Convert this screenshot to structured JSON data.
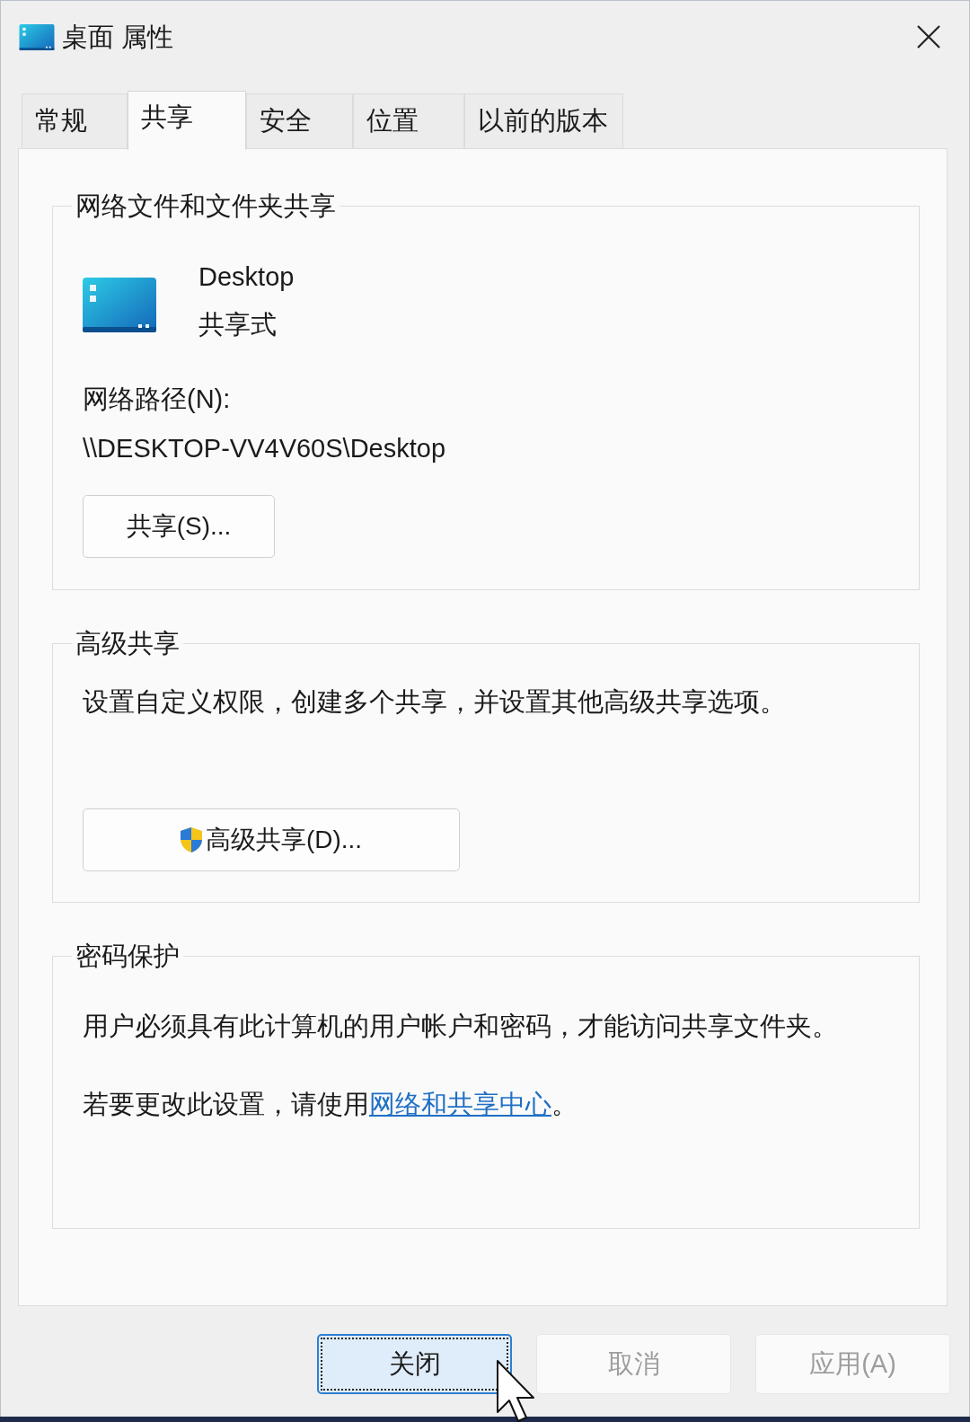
{
  "window": {
    "title": "桌面 属性"
  },
  "tabs": [
    {
      "label": "常规",
      "selected": false
    },
    {
      "label": "共享",
      "selected": true
    },
    {
      "label": "安全",
      "selected": false
    },
    {
      "label": "位置",
      "selected": false
    },
    {
      "label": "以前的版本",
      "selected": false
    }
  ],
  "network_sharing": {
    "heading": "网络文件和文件夹共享",
    "name": "Desktop",
    "status": "共享式",
    "path_label": "网络路径(N):",
    "path": "\\\\DESKTOP-VV4V60S\\Desktop",
    "button": "共享(S)..."
  },
  "advanced_sharing": {
    "heading": "高级共享",
    "description": "设置自定义权限，创建多个共享，并设置其他高级共享选项。",
    "button": "高级共享(D)..."
  },
  "password_protection": {
    "heading": "密码保护",
    "description": "用户必须具有此计算机的用户帐户和密码，才能访问共享文件夹。",
    "note": {
      "before": "若要更改此设置，请使用",
      "link": "网络和共享中心",
      "after": "。"
    }
  },
  "buttons": [
    {
      "label": "关闭",
      "disabled": false,
      "focused": true
    },
    {
      "label": "取消",
      "disabled": true,
      "focused": false
    },
    {
      "label": "应用(A)",
      "disabled": true,
      "focused": false
    }
  ]
}
